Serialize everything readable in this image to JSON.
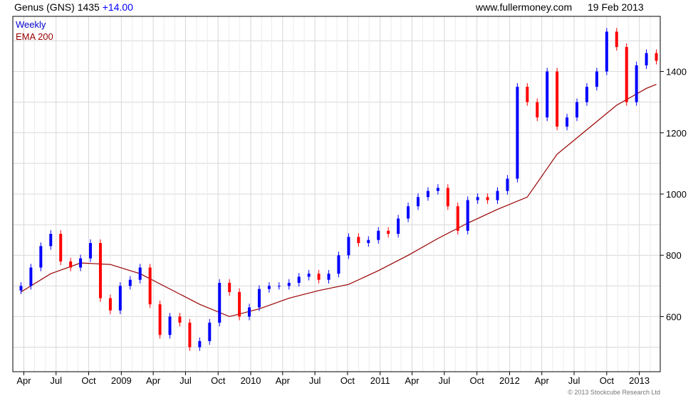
{
  "header": {
    "title": "Genus (GNS) 1435",
    "change": "+14.00",
    "website": "www.fullermoney.com",
    "date": "19 Feb 2013"
  },
  "credit": "© 2013 Stockcube Research Ltd",
  "colors": {
    "up_candle": "#0000ff",
    "down_candle": "#ff0000",
    "ema_line": "#990000",
    "grid": "#d8d8d8",
    "frame": "#000000"
  },
  "chart_data": {
    "type": "line",
    "legend": [
      "Weekly",
      "EMA 200"
    ],
    "legend_placement": "top-left",
    "x_tick_labels": [
      "Apr",
      "Jul",
      "Oct",
      "2009",
      "Apr",
      "Jul",
      "Oct",
      "2010",
      "Apr",
      "Jul",
      "Oct",
      "2011",
      "Apr",
      "Jul",
      "Oct",
      "2012",
      "Apr",
      "Jul",
      "Oct",
      "2013"
    ],
    "y_tick_labels": [
      600,
      800,
      1000,
      1200,
      1400
    ],
    "ylim": [
      420,
      1580
    ],
    "y_axis_side": "right",
    "grid": true,
    "series": [
      {
        "name": "Weekly",
        "style": "candlestick",
        "x": [
          "2008-03-24",
          "2008-04-21",
          "2008-05-19",
          "2008-06-16",
          "2008-07-14",
          "2008-08-11",
          "2008-09-08",
          "2008-10-06",
          "2008-11-03",
          "2008-12-01",
          "2008-12-29",
          "2009-01-26",
          "2009-02-23",
          "2009-03-23",
          "2009-04-20",
          "2009-05-18",
          "2009-06-15",
          "2009-07-13",
          "2009-08-10",
          "2009-09-07",
          "2009-10-05",
          "2009-11-02",
          "2009-11-30",
          "2009-12-28",
          "2010-01-25",
          "2010-02-22",
          "2010-03-22",
          "2010-04-19",
          "2010-05-17",
          "2010-06-14",
          "2010-07-12",
          "2010-08-09",
          "2010-09-06",
          "2010-10-04",
          "2010-11-01",
          "2010-11-29",
          "2010-12-27",
          "2011-01-24",
          "2011-02-21",
          "2011-03-21",
          "2011-04-18",
          "2011-05-16",
          "2011-06-13",
          "2011-07-11",
          "2011-08-08",
          "2011-09-05",
          "2011-10-03",
          "2011-10-31",
          "2011-11-28",
          "2011-12-26",
          "2012-01-23",
          "2012-02-20",
          "2012-03-19",
          "2012-04-16",
          "2012-05-14",
          "2012-06-11",
          "2012-07-09",
          "2012-08-06",
          "2012-09-03",
          "2012-10-01",
          "2012-10-29",
          "2012-11-26",
          "2012-12-24",
          "2013-01-21",
          "2013-02-18"
        ],
        "values": [
          700,
          760,
          830,
          870,
          780,
          760,
          790,
          840,
          660,
          620,
          700,
          720,
          760,
          640,
          540,
          600,
          580,
          500,
          520,
          580,
          710,
          680,
          600,
          630,
          690,
          700,
          700,
          710,
          730,
          740,
          720,
          740,
          800,
          860,
          840,
          850,
          880,
          870,
          920,
          960,
          990,
          1010,
          1020,
          960,
          880,
          980,
          990,
          980,
          1010,
          1050,
          1350,
          1300,
          1250,
          1400,
          1220,
          1250,
          1300,
          1350,
          1400,
          1530,
          1480,
          1300,
          1420,
          1460,
          1435
        ]
      },
      {
        "name": "EMA 200",
        "style": "line",
        "x": [
          "2008-03-24",
          "2008-06-16",
          "2008-09-08",
          "2008-12-01",
          "2009-02-23",
          "2009-05-18",
          "2009-08-10",
          "2009-11-02",
          "2010-01-25",
          "2010-04-19",
          "2010-07-12",
          "2010-10-04",
          "2010-12-27",
          "2011-03-21",
          "2011-06-13",
          "2011-09-05",
          "2011-11-28",
          "2012-02-20",
          "2012-05-14",
          "2012-08-06",
          "2012-10-29",
          "2013-01-21",
          "2013-02-18"
        ],
        "values": [
          680,
          740,
          775,
          770,
          740,
          690,
          640,
          600,
          625,
          660,
          685,
          705,
          750,
          800,
          855,
          905,
          950,
          990,
          1130,
          1210,
          1290,
          1345,
          1358
        ]
      }
    ]
  }
}
